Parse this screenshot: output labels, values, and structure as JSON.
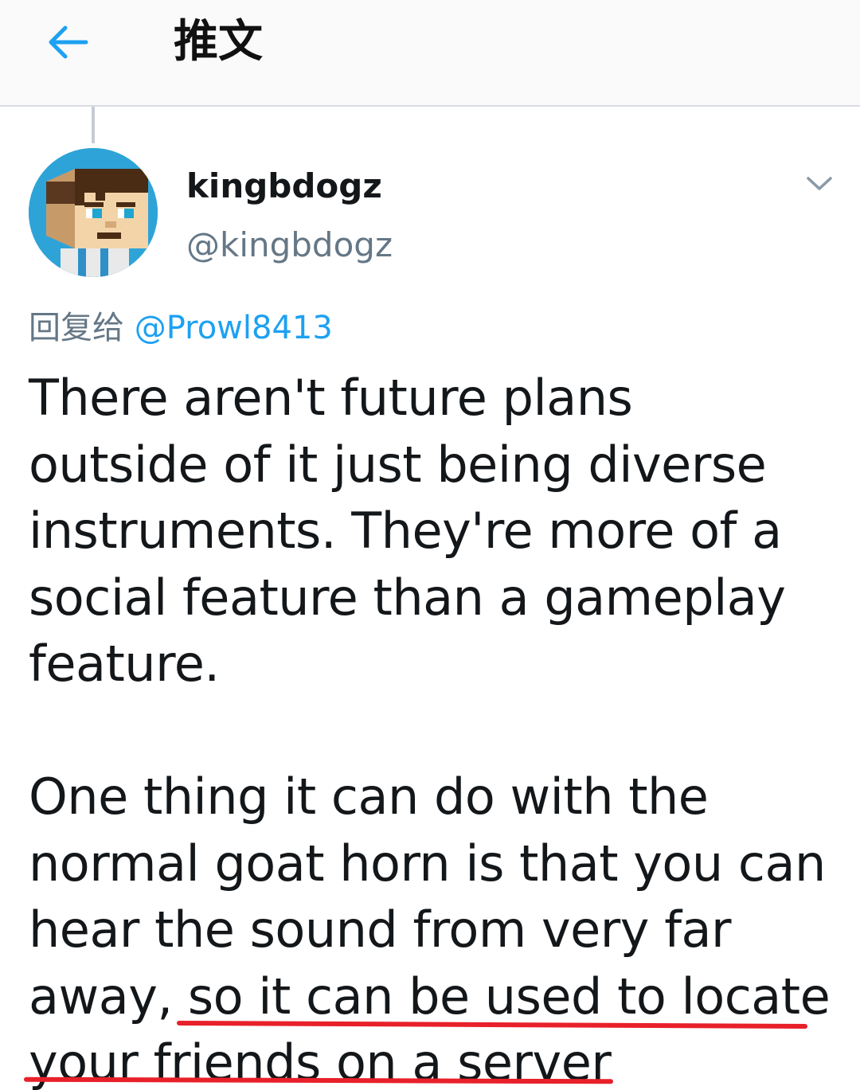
{
  "header": {
    "title": "推文",
    "back_icon": "arrow-left-icon",
    "accent_color": "#1da1f2"
  },
  "tweet": {
    "author": {
      "display_name": "kingbdogz",
      "handle": "@kingbdogz",
      "avatar_icon": "minecraft-avatar-icon"
    },
    "more_icon": "chevron-down-icon",
    "reply_to": {
      "prefix": "回复给",
      "mention": "@Prowl8413"
    },
    "paragraph_1": {
      "lines": [
        "There aren't future plans",
        "outside of it just being diverse",
        "instruments. They're more of a",
        "social feature than a gameplay",
        "feature."
      ]
    },
    "paragraph_2": {
      "lines": [
        "One thing it can do with the",
        "normal goat horn is that you can",
        "hear the sound from very far"
      ],
      "line_4_plain": "away, ",
      "line_4_highlight": "so it can be used to locate",
      "line_5_highlight": "your friends on a server"
    },
    "highlight_color": "#e8202a"
  }
}
